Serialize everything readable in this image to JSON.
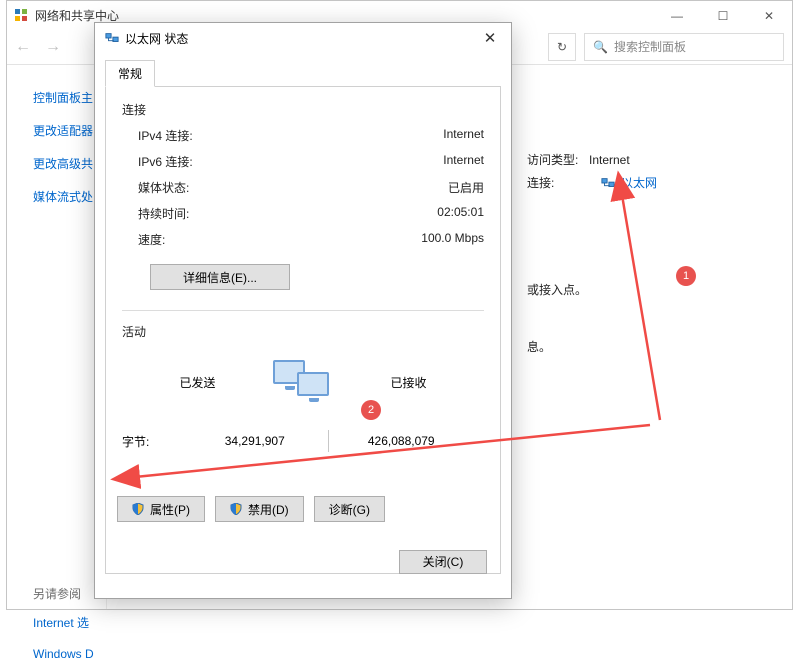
{
  "bg": {
    "title": "网络和共享中心",
    "search_placeholder": "搜索控制面板",
    "sidebar": {
      "items": [
        "控制面板主",
        "更改适配器",
        "更改高级共",
        "媒体流式处"
      ],
      "see_also_label": "另请参阅",
      "see_also": [
        "Internet 选",
        "Windows D"
      ]
    },
    "content": {
      "access_label": "访问类型:",
      "access_value": "Internet",
      "conn_label": "连接:",
      "conn_link": "以太网",
      "hint1": "或接入点。",
      "hint2": "息。"
    }
  },
  "dlg": {
    "title": "以太网 状态",
    "tab": "常规",
    "group_conn": "连接",
    "rows": {
      "ipv4_k": "IPv4 连接:",
      "ipv4_v": "Internet",
      "ipv6_k": "IPv6 连接:",
      "ipv6_v": "Internet",
      "media_k": "媒体状态:",
      "media_v": "已启用",
      "dur_k": "持续时间:",
      "dur_v": "02:05:01",
      "spd_k": "速度:",
      "spd_v": "100.0 Mbps"
    },
    "details_btn": "详细信息(E)...",
    "group_act": "活动",
    "sent_label": "已发送",
    "recv_label": "已接收",
    "bytes_label": "字节:",
    "bytes_sent": "34,291,907",
    "bytes_recv": "426,088,079",
    "btn_props": "属性(P)",
    "btn_disable": "禁用(D)",
    "btn_diag": "诊断(G)",
    "btn_close": "关闭(C)"
  },
  "annot": {
    "b1": "1",
    "b2": "2"
  }
}
